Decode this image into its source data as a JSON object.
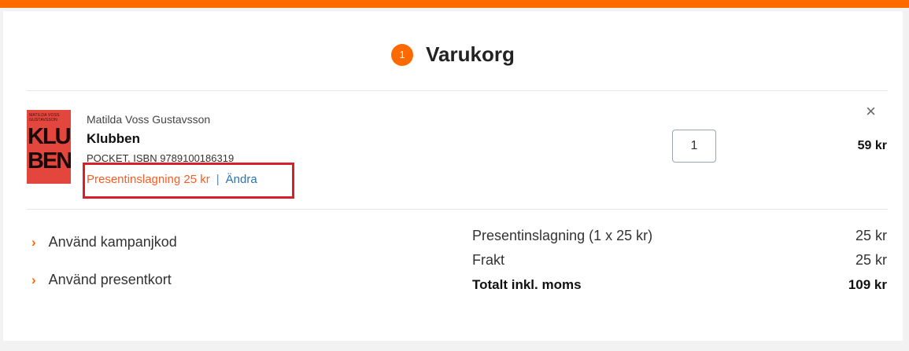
{
  "cart": {
    "badge_count": "1",
    "title": "Varukorg"
  },
  "item": {
    "cover_top_text": "MATILDA VOSS GUSTAVSSON",
    "cover_big_line1": "KLUB",
    "cover_big_line2": "BEN",
    "author": "Matilda Voss Gustavsson",
    "title": "Klubben",
    "format": "POCKET, ISBN 9789100186319",
    "gift_wrap": "Presentinslagning 25 kr",
    "separator": "|",
    "change_label": "Ändra",
    "quantity": "1",
    "price": "59 kr",
    "remove_icon": "×"
  },
  "links": {
    "campaign_code": "Använd kampanjkod",
    "gift_card": "Använd presentkort",
    "chevron": "›"
  },
  "summary": {
    "gift_wrap_label": "Presentinslagning (1 x 25 kr)",
    "gift_wrap_value": "25 kr",
    "shipping_label": "Frakt",
    "shipping_value": "25 kr",
    "total_label": "Totalt inkl. moms",
    "total_value": "109 kr"
  },
  "colors": {
    "accent": "#ff6a00",
    "link": "#2b72b6",
    "highlight_border": "#d9202a"
  }
}
